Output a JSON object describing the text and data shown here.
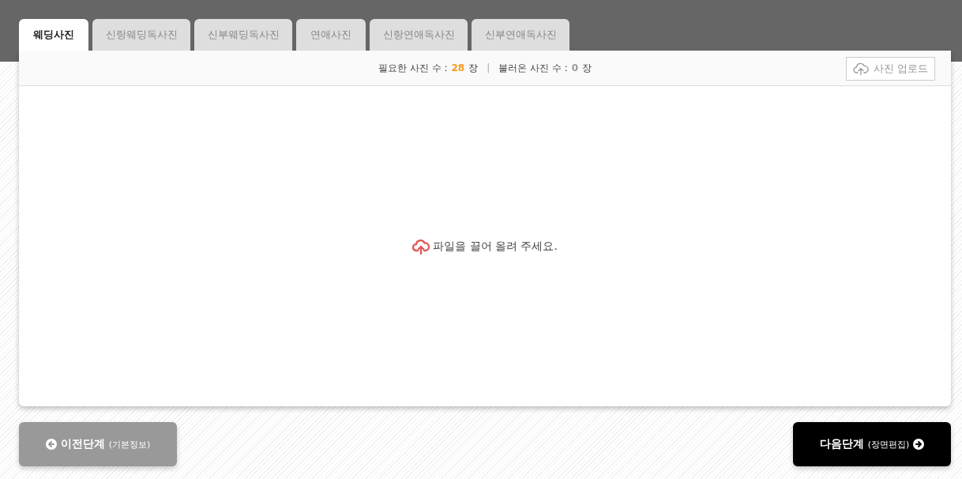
{
  "tabs": [
    {
      "label": "웨딩사진",
      "selected": true
    },
    {
      "label": "신랑웨딩독사진",
      "selected": false
    },
    {
      "label": "신부웨딩독사진",
      "selected": false
    },
    {
      "label": "연애사진",
      "selected": false
    },
    {
      "label": "신랑연애독사진",
      "selected": false
    },
    {
      "label": "신부연애독사진",
      "selected": false
    }
  ],
  "stats": [
    {
      "label": "필요한 사진 수 :",
      "count": "28",
      "unit": "장",
      "color": "#f59b1c"
    },
    {
      "label": "불러온 사진 수 :",
      "count": "0",
      "unit": "장",
      "color": "#999999"
    }
  ],
  "separator": "|",
  "upload_button": "사진 업로드",
  "drop_hint": "파일을 끌어 올려 주세요.",
  "prev_button": {
    "label": "이전단계",
    "sub": "(기본정보)"
  },
  "next_button": {
    "label": "다음단계",
    "sub": "(장면편집)"
  }
}
